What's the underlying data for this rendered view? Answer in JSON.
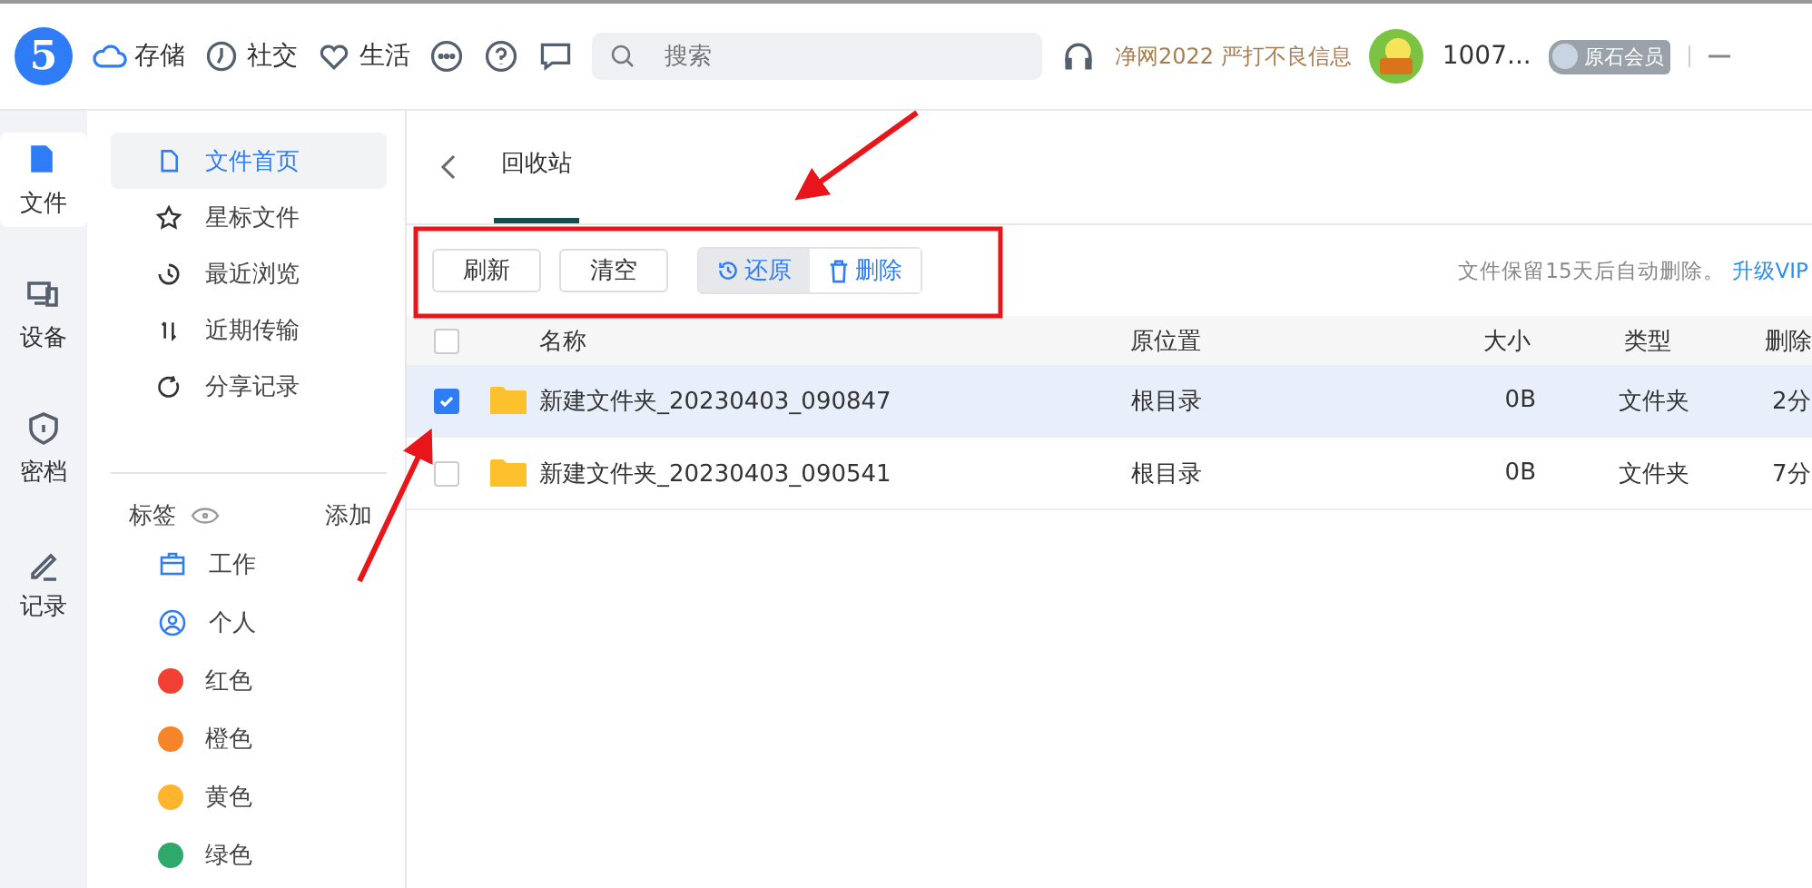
{
  "topbar": {
    "logo": "5",
    "nav": [
      {
        "label": "存储",
        "selected": true
      },
      {
        "label": "社交",
        "selected": false
      },
      {
        "label": "生活",
        "selected": false
      }
    ],
    "search": {
      "placeholder": "搜索"
    },
    "promo": "净网2022 严打不良信息",
    "user": "1007...",
    "member": "原石会员"
  },
  "rail": [
    {
      "label": "文件",
      "selected": true
    },
    {
      "label": "设备",
      "selected": false
    },
    {
      "label": "密档",
      "selected": false
    },
    {
      "label": "记录",
      "selected": false
    }
  ],
  "sidebar": {
    "items": [
      {
        "label": "文件首页",
        "selected": true
      },
      {
        "label": "星标文件",
        "selected": false
      },
      {
        "label": "最近浏览",
        "selected": false
      },
      {
        "label": "近期传输",
        "selected": false
      },
      {
        "label": "分享记录",
        "selected": false
      }
    ],
    "tags_title": "标签",
    "tags_add": "添加",
    "tags": [
      {
        "label": "工作",
        "kind": "icon"
      },
      {
        "label": "个人",
        "kind": "icon"
      },
      {
        "label": "红色",
        "kind": "dot",
        "color": "#f04134"
      },
      {
        "label": "橙色",
        "kind": "dot",
        "color": "#f5842a"
      },
      {
        "label": "黄色",
        "kind": "dot",
        "color": "#fdb52f"
      },
      {
        "label": "绿色",
        "kind": "dot",
        "color": "#2fa86c"
      }
    ]
  },
  "tab": "回收站",
  "toolbar": {
    "buttons": [
      "刷新",
      "清空"
    ],
    "restore": "还原",
    "delete": "删除",
    "notice": "文件保留15天后自动删除。",
    "vip_link": "升级VIP"
  },
  "table": {
    "all_checked": false,
    "columns": [
      "名称",
      "原位置",
      "大小",
      "类型",
      "删除"
    ],
    "rows": [
      {
        "name": "新建文件夹_20230403_090847",
        "location": "根目录",
        "size": "0B",
        "type": "文件夹",
        "deleted": "2分",
        "checked": true
      },
      {
        "name": "新建文件夹_20230403_090541",
        "location": "根目录",
        "size": "0B",
        "type": "文件夹",
        "deleted": "7分",
        "checked": false
      }
    ]
  }
}
